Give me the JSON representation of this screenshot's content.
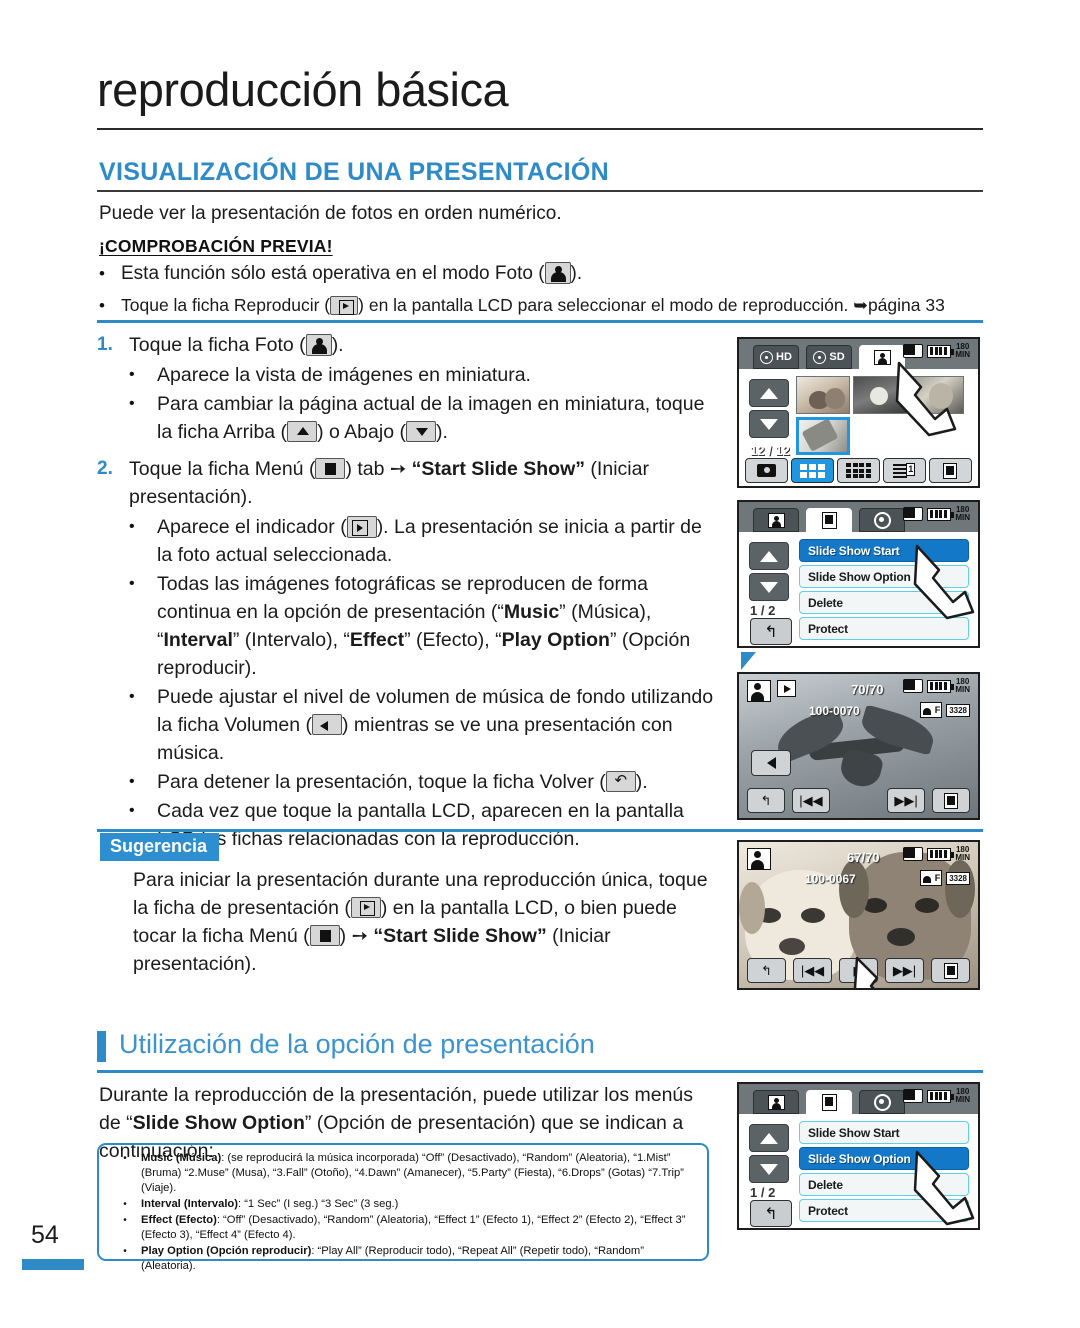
{
  "chapter": {
    "title": "reproducción básica"
  },
  "section": {
    "title": "VISUALIZACIÓN DE UNA PRESENTACIÓN",
    "lead": "Puede ver la presentación de fotos en orden numérico.",
    "precheck_title": "¡COMPROBACIÓN PREVIA!",
    "precheck": [
      {
        "before": "Esta función sólo está operativa en el modo Foto (",
        "icon": "photo-icon",
        "after": ")."
      },
      {
        "before": "Toque la ficha Reproducir (",
        "icon": "play-icon",
        "after": ") en la pantalla LCD para seleccionar el modo de reproducción. ➥página 33"
      }
    ]
  },
  "steps": [
    {
      "num": "1.",
      "text_before": "Toque la ficha Foto (",
      "icon": "photo-icon",
      "text_after": ").",
      "subs": [
        {
          "parts": [
            {
              "t": "Aparece la vista de imágenes en miniatura."
            }
          ]
        },
        {
          "parts": [
            {
              "t": "Para cambiar la página actual de la imagen en miniatura, toque la ficha Arriba ("
            },
            {
              "icon": "chevron-up-icon"
            },
            {
              "t": ") o Abajo ("
            },
            {
              "icon": "chevron-down-icon"
            },
            {
              "t": ")."
            }
          ]
        }
      ]
    },
    {
      "num": "2.",
      "text_before": "Toque la ficha Menú (",
      "icon": "menu-icon",
      "text_after": ") tab ➙ ",
      "bold": "“Start Slide Show”",
      "text_end": " (Iniciar presentación).",
      "subs": [
        {
          "parts": [
            {
              "t": "Aparece el indicador ("
            },
            {
              "icon": "slideshow-icon"
            },
            {
              "t": "). La presentación se inicia a partir de la foto actual seleccionada."
            }
          ]
        },
        {
          "parts": [
            {
              "t": "Todas las imágenes fotográficas se reproducen de forma continua en la opción de presentación (“"
            },
            {
              "b": "Music"
            },
            {
              "t": "” (Música), “"
            },
            {
              "b": "Interval"
            },
            {
              "t": "” (Intervalo), “"
            },
            {
              "b": "Effect"
            },
            {
              "t": "” (Efecto), “"
            },
            {
              "b": "Play Option"
            },
            {
              "t": "” (Opción reproducir)."
            }
          ]
        },
        {
          "parts": [
            {
              "t": "Puede ajustar el nivel de volumen de música de fondo utilizando la ficha Volumen ("
            },
            {
              "icon": "volume-icon"
            },
            {
              "t": ") mientras se ve una presentación con música."
            }
          ]
        },
        {
          "parts": [
            {
              "t": "Para detener la presentación, toque la ficha Volver ("
            },
            {
              "icon": "back-icon"
            },
            {
              "t": ")."
            }
          ]
        },
        {
          "parts": [
            {
              "t": "Cada vez que toque la pantalla LCD, aparecen en la pantalla LCD las fichas relacionadas con la reproducción."
            }
          ]
        }
      ]
    }
  ],
  "tip": {
    "badge": "Sugerencia",
    "parts": [
      {
        "t": "Para iniciar la presentación durante una reproducción única, toque la ficha de presentación ("
      },
      {
        "icon": "play-icon"
      },
      {
        "t": ") en la pantalla LCD, o bien puede tocar la ficha Menú ("
      },
      {
        "icon": "menu-icon"
      },
      {
        "t": ") ➙ "
      },
      {
        "b": "“Start Slide Show”"
      },
      {
        "t": " (Iniciar presentación)."
      }
    ]
  },
  "subsection": {
    "title": "Utilización de la opción de presentación",
    "parts": [
      {
        "t": "Durante la reproducción de la presentación, puede utilizar los menús de “"
      },
      {
        "b": "Slide Show Option"
      },
      {
        "t": "” (Opción de presentación) que se indican a continuación:"
      }
    ]
  },
  "notes": [
    {
      "label": "Music (Música)",
      "text": ": (se reproducirá la música incorporada) “Off” (Desactivado), “Random” (Aleatoria), “1.Mist” (Bruma) “2.Muse” (Musa), “3.Fall” (Otoño), “4.Dawn” (Amanecer), “5.Party” (Fiesta), “6.Drops” (Gotas) “7.Trip” (Viaje)."
    },
    {
      "label": "Interval (Intervalo)",
      "text": ": “1 Sec” (I seg.) “3 Sec” (3 seg.)"
    },
    {
      "label": "Effect (Efecto)",
      "text": ": “Off” (Desactivado), “Random” (Aleatoria), “Effect 1” (Efecto 1), “Effect 2” (Efecto 2), “Effect 3” (Efecto 3), “Effect 4” (Efecto 4)."
    },
    {
      "label": "Play Option (Opción reproducir)",
      "text": ": “Play All” (Reproducir todo), “Repeat All” (Repetir todo), “Random” (Aleatoria)."
    }
  ],
  "page_number": "54",
  "colors": {
    "accent": "#2e8bc8",
    "heading_blue": "#3b93cf",
    "selected_blue": "#1478c8",
    "lcd_bg": "#8e9396"
  },
  "screens": {
    "thumbnail_view": {
      "tabs": [
        {
          "label": "HD",
          "icon": "film-reel-icon",
          "active": false
        },
        {
          "label": "SD",
          "icon": "film-reel-icon",
          "active": false
        },
        {
          "label": "",
          "icon": "photo-tab-icon",
          "active": true
        }
      ],
      "status": {
        "card": "card-icon",
        "battery": "battery-icon",
        "battery_label_top": "180",
        "battery_label_bottom": "MIN"
      },
      "page_count": "12 / 12",
      "toolbar": [
        "camera-icon",
        "grid-6-icon",
        "grid-12-icon",
        "date-list-icon",
        "menu-icon"
      ],
      "toolbar_selected_index": 1
    },
    "menu_slide_show_start": {
      "tabs": [
        {
          "icon": "photo-stack-tab-icon",
          "active": false
        },
        {
          "icon": "menu-tab-icon",
          "active": true
        },
        {
          "icon": "gear-tab-icon",
          "active": false
        }
      ],
      "status": {
        "battery_label_top": "180",
        "battery_label_bottom": "MIN"
      },
      "items": [
        "Slide Show Start",
        "Slide Show Option",
        "Delete",
        "Protect"
      ],
      "selected_index": 0,
      "page_count": "1 / 2",
      "back": "back-icon"
    },
    "photo_bird": {
      "count": "70/70",
      "file": "100-0070",
      "indicators": [
        "photo-stack-icon",
        "slideshow-indicator-icon"
      ],
      "status": {
        "battery_label_top": "180",
        "battery_label_bottom": "MIN"
      },
      "quality": "F",
      "resolution": "3328",
      "volume": "volume-icon",
      "buttons": [
        "back-icon",
        "prev-icon",
        "next-icon",
        "menu-icon"
      ]
    },
    "photo_puppies": {
      "count": "67/70",
      "file": "100-0067",
      "indicators": [
        "photo-stack-icon"
      ],
      "status": {
        "battery_label_top": "180",
        "battery_label_bottom": "MIN"
      },
      "quality": "F",
      "resolution": "3328",
      "buttons": [
        "back-icon",
        "prev-icon",
        "slideshow-icon",
        "next-icon",
        "menu-icon"
      ],
      "highlighted_button_index": 2
    },
    "menu_slide_show_option": {
      "tabs": [
        {
          "icon": "photo-stack-tab-icon",
          "active": false
        },
        {
          "icon": "menu-tab-icon",
          "active": true
        },
        {
          "icon": "gear-tab-icon",
          "active": false
        }
      ],
      "status": {
        "battery_label_top": "180",
        "battery_label_bottom": "MIN"
      },
      "items": [
        "Slide Show Start",
        "Slide Show Option",
        "Delete",
        "Protect"
      ],
      "selected_index": 1,
      "page_count": "1 / 2",
      "back": "back-icon"
    }
  }
}
